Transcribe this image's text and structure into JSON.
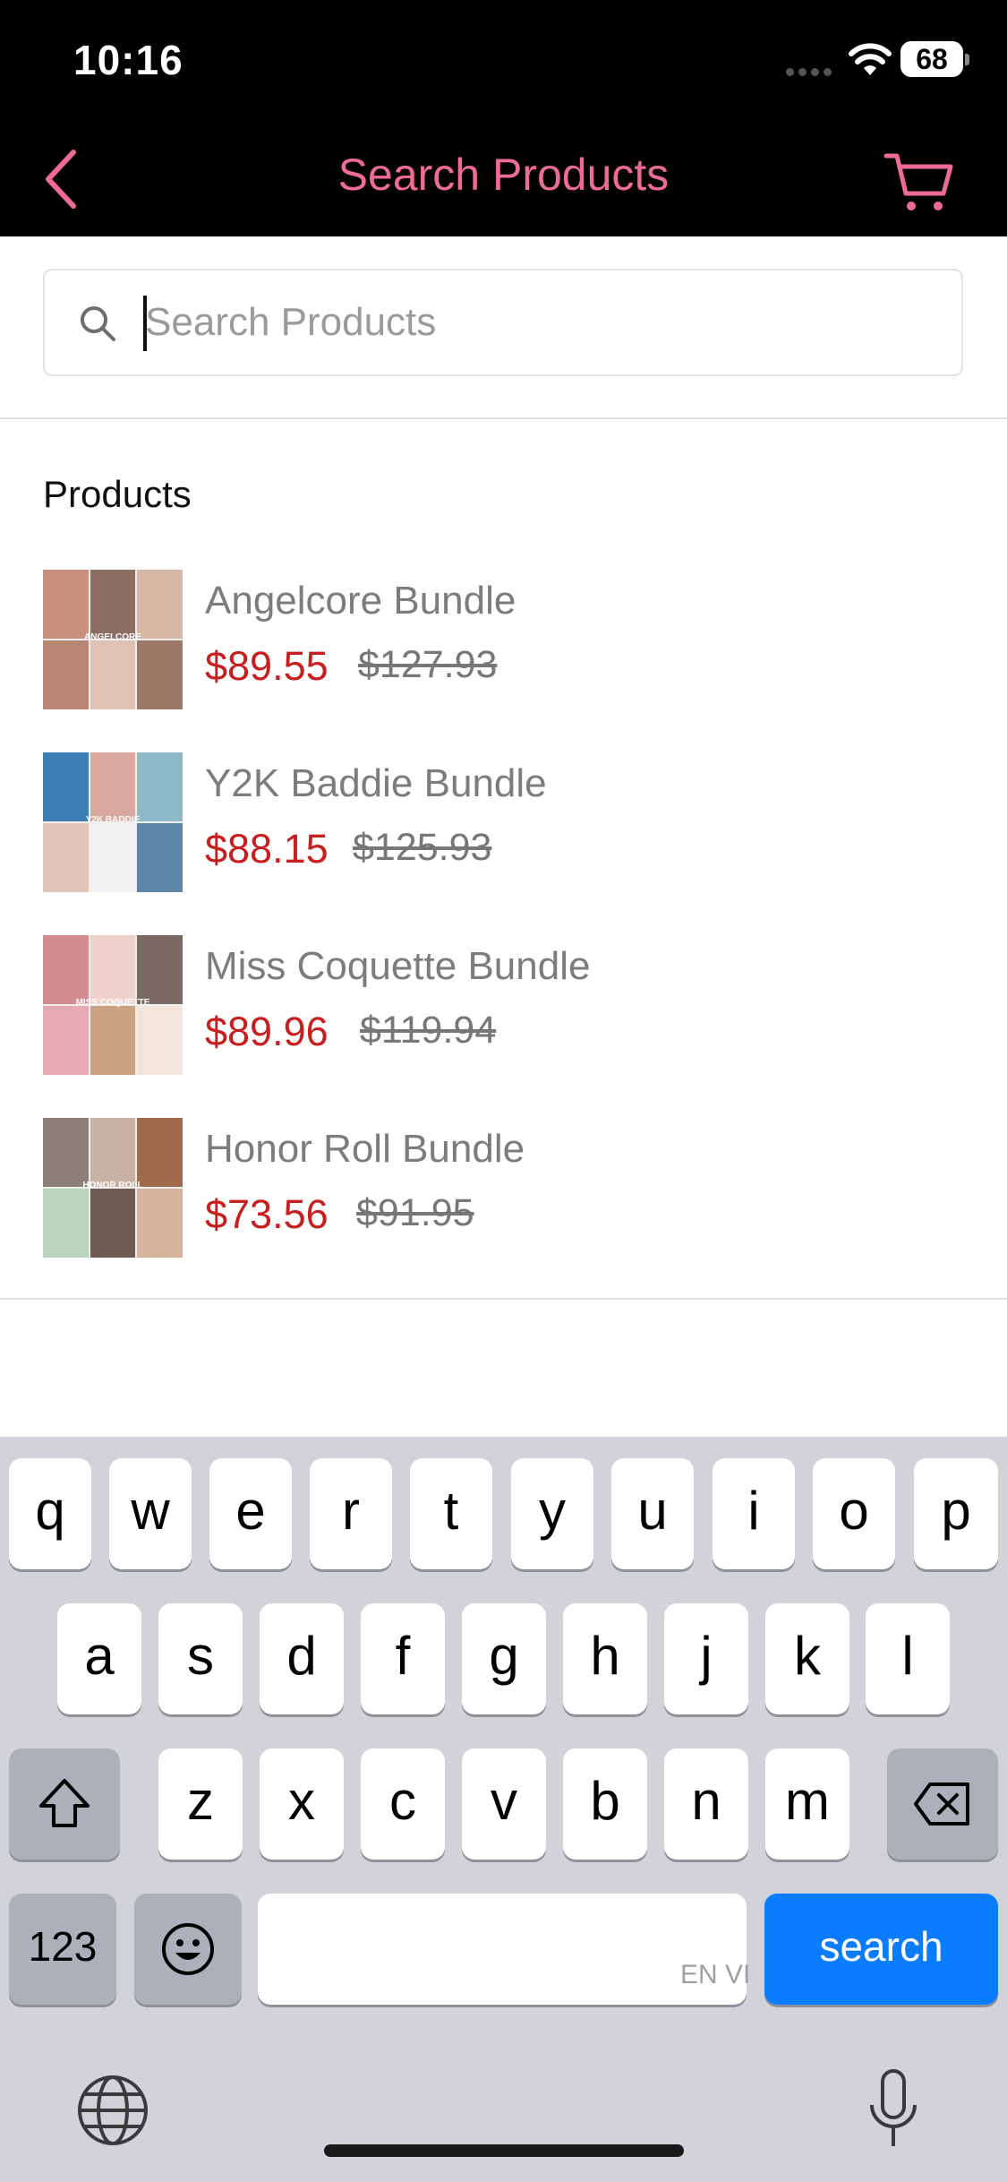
{
  "status_bar": {
    "time": "10:16",
    "battery": "68"
  },
  "nav": {
    "title": "Search Products"
  },
  "search": {
    "placeholder": "Search Products"
  },
  "section": {
    "heading": "Products"
  },
  "colors": {
    "accent": "#ee6b93",
    "price": "#c81e1e",
    "search_key": "#0a7cff"
  },
  "products": [
    {
      "name": "Angelcore Bundle",
      "price": "$89.55",
      "old_price": "$127.93",
      "thumb_label": "ANGELCORE"
    },
    {
      "name": "Y2K Baddie Bundle",
      "price": "$88.15",
      "old_price": "$125.93",
      "thumb_label": "Y2K BADDIE"
    },
    {
      "name": "Miss Coquette Bundle",
      "price": "$89.96",
      "old_price": "$119.94",
      "thumb_label": "MISS COQUETTE"
    },
    {
      "name": "Honor Roll Bundle",
      "price": "$73.56",
      "old_price": "$91.95",
      "thumb_label": "HONOR ROLL"
    }
  ],
  "keyboard": {
    "row1": [
      "q",
      "w",
      "e",
      "r",
      "t",
      "y",
      "u",
      "i",
      "o",
      "p"
    ],
    "row2": [
      "a",
      "s",
      "d",
      "f",
      "g",
      "h",
      "j",
      "k",
      "l"
    ],
    "row3": [
      "z",
      "x",
      "c",
      "v",
      "b",
      "n",
      "m"
    ],
    "numbers_key": "123",
    "search_key": "search",
    "space_lang": "EN VI",
    "icons": [
      "shift-icon",
      "backspace-icon",
      "emoji-icon",
      "globe-icon",
      "microphone-icon"
    ]
  }
}
